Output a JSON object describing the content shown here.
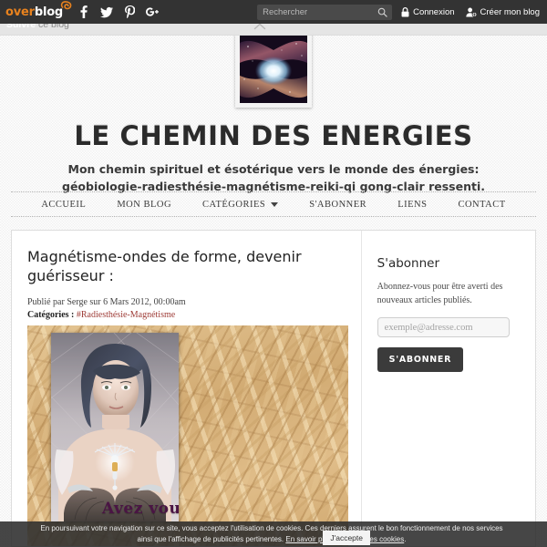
{
  "toolbar": {
    "logo_over": "over",
    "logo_blog": "blog",
    "social": [
      {
        "name": "facebook-icon",
        "label": "f"
      },
      {
        "name": "twitter-icon",
        "label": "Twitter"
      },
      {
        "name": "pinterest-icon",
        "label": "P"
      },
      {
        "name": "google-plus-icon",
        "label": "g+"
      }
    ],
    "search_placeholder": "Rechercher",
    "search_value": "",
    "login_label": "Connexion",
    "create_blog_label": "Créer mon blog"
  },
  "follow_bar": {
    "label_bold": "Suivre",
    "label_rest": " ce blog"
  },
  "header": {
    "logo_alt": "hands-holding-light",
    "title": "LE CHEMIN DES ENERGIES",
    "tagline_line1": "Mon chemin spirituel et ésotérique vers le monde des énergies:",
    "tagline_line2": "géobiologie-radiesthésie-magnétisme-reiki-qi gong-clair ressenti."
  },
  "nav": {
    "items": [
      {
        "label": "ACCUEIL",
        "has_caret": false
      },
      {
        "label": "MON BLOG",
        "has_caret": false
      },
      {
        "label": "CATÉGORIES",
        "has_caret": true
      },
      {
        "label": "S'ABONNER",
        "has_caret": false
      },
      {
        "label": "LIENS",
        "has_caret": false
      },
      {
        "label": "CONTACT",
        "has_caret": false
      }
    ]
  },
  "article": {
    "title": "Magnétisme-ondes de forme, devenir guérisseur :",
    "meta": "Publié par Serge sur 6 Mars 2012, 00:00am",
    "categories_label": "Catégories :",
    "category_link": "#Radiesthésie-Magnétisme",
    "image_overlay_text": "Avez vou"
  },
  "sidebar": {
    "widget_title": "S'abonner",
    "widget_description": "Abonnez-vous pour être averti des nouveaux articles publiés.",
    "email_placeholder": "exemple@adresse.com",
    "email_value": "",
    "subscribe_button": "S'ABONNER"
  },
  "cookie": {
    "text_part1": "En poursuivant votre navigation sur ce site, vous acceptez l'utilisation de cookies. Ces derniers assurent le bon fonctionnement de nos services ainsi que l'affichage de publicités pertinentes. ",
    "learn_more": "En savoir plus et agir sur les cookies",
    "text_part2": ".",
    "accept_label": "J'accepte"
  },
  "colors": {
    "brand_orange": "#e8821e",
    "toolbar_dark": "#333333",
    "category_link": "#9e3b36",
    "button_dark": "#3b3b3b"
  }
}
